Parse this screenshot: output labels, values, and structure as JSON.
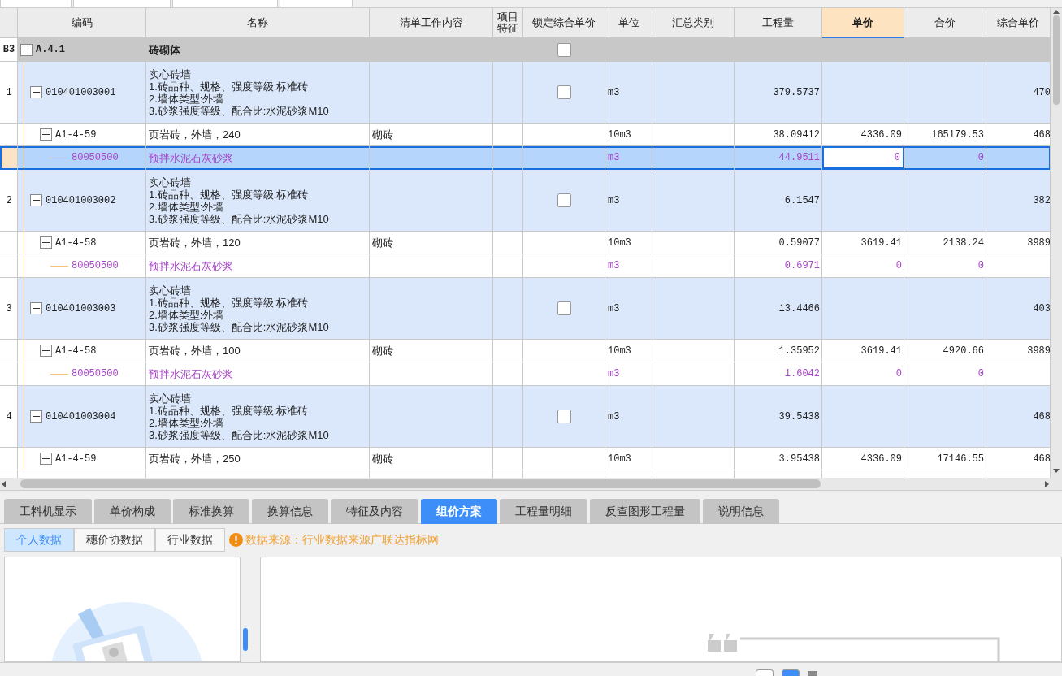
{
  "table": {
    "columns": [
      {
        "selected": false
      },
      {
        "label": "编码",
        "selected": false
      },
      {
        "label": "名称",
        "selected": false
      },
      {
        "label": "清单工作内容",
        "selected": false
      },
      {
        "label": "项目特征",
        "selected": false
      },
      {
        "label": "锁定综合单价",
        "selected": false
      },
      {
        "label": "单位",
        "selected": false
      },
      {
        "label": "汇总类别",
        "selected": false
      },
      {
        "label": "工程量",
        "selected": false
      },
      {
        "label": "单价",
        "selected": true
      },
      {
        "label": "合价",
        "selected": false
      },
      {
        "label": "综合单价",
        "selected": false
      }
    ],
    "rows": [
      {
        "kind": "group",
        "row_no": "B3",
        "code": "A.4.1",
        "name_lines": [
          "砖砌体"
        ],
        "expanded": true,
        "locked": false,
        "selected": false,
        "children": [
          {
            "kind": "item",
            "row_no": "1",
            "code": "010401003001",
            "name_lines": [
              "实心砖墙",
              "1.砖品种、规格、强度等级:标准砖",
              "2.墙体类型:外墙",
              "3.砂浆强度等级、配合比:水泥砂浆M10"
            ],
            "unit": "m3",
            "quantity": "379.5737",
            "composite": "470",
            "expanded": true,
            "locked": false,
            "selected": false,
            "children": [
              {
                "kind": "sub",
                "code": "A1-4-59",
                "name_lines": [
                  "页岩砖，外墙，240"
                ],
                "work": "砌砖",
                "unit": "10m3",
                "quantity": "38.09412",
                "price": "4336.09",
                "total": "165179.53",
                "composite": "468",
                "expanded": true,
                "selected": false,
                "children": [
                  {
                    "kind": "material",
                    "code": "80050500",
                    "name_lines": [
                      "预拌水泥石灰砂浆"
                    ],
                    "unit": "m3",
                    "quantity": "44.9511",
                    "price": "0",
                    "total": "0",
                    "selected": true
                  }
                ]
              }
            ]
          },
          {
            "kind": "item",
            "row_no": "2",
            "code": "010401003002",
            "name_lines": [
              "实心砖墙",
              "1.砖品种、规格、强度等级:标准砖",
              "2.墙体类型:外墙",
              "3.砂浆强度等级、配合比:水泥砂浆M10"
            ],
            "unit": "m3",
            "quantity": "6.1547",
            "composite": "382",
            "expanded": true,
            "locked": false,
            "selected": false,
            "children": [
              {
                "kind": "sub",
                "code": "A1-4-58",
                "name_lines": [
                  "页岩砖，外墙，120"
                ],
                "work": "砌砖",
                "unit": "10m3",
                "quantity": "0.59077",
                "price": "3619.41",
                "total": "2138.24",
                "composite": "3989",
                "expanded": true,
                "selected": false,
                "children": [
                  {
                    "kind": "material",
                    "code": "80050500",
                    "name_lines": [
                      "预拌水泥石灰砂浆"
                    ],
                    "unit": "m3",
                    "quantity": "0.6971",
                    "price": "0",
                    "total": "0",
                    "selected": false
                  }
                ]
              }
            ]
          },
          {
            "kind": "item",
            "row_no": "3",
            "code": "010401003003",
            "name_lines": [
              "实心砖墙",
              "1.砖品种、规格、强度等级:标准砖",
              "2.墙体类型:外墙",
              "3.砂浆强度等级、配合比:水泥砂浆M10"
            ],
            "unit": "m3",
            "quantity": "13.4466",
            "composite": "403",
            "expanded": true,
            "locked": false,
            "selected": false,
            "children": [
              {
                "kind": "sub",
                "code": "A1-4-58",
                "name_lines": [
                  "页岩砖，外墙，100"
                ],
                "work": "砌砖",
                "unit": "10m3",
                "quantity": "1.35952",
                "price": "3619.41",
                "total": "4920.66",
                "composite": "3989",
                "expanded": true,
                "selected": false,
                "children": [
                  {
                    "kind": "material",
                    "code": "80050500",
                    "name_lines": [
                      "预拌水泥石灰砂浆"
                    ],
                    "unit": "m3",
                    "quantity": "1.6042",
                    "price": "0",
                    "total": "0",
                    "selected": false
                  }
                ]
              }
            ]
          },
          {
            "kind": "item",
            "row_no": "4",
            "code": "010401003004",
            "name_lines": [
              "实心砖墙",
              "1.砖品种、规格、强度等级:标准砖",
              "2.墙体类型:外墙",
              "3.砂浆强度等级、配合比:水泥砂浆M10"
            ],
            "unit": "m3",
            "quantity": "39.5438",
            "composite": "468",
            "expanded": true,
            "locked": false,
            "selected": false,
            "children": [
              {
                "kind": "sub",
                "code": "A1-4-59",
                "name_lines": [
                  "页岩砖，外墙，250"
                ],
                "work": "砌砖",
                "unit": "10m3",
                "quantity": "3.95438",
                "price": "4336.09",
                "total": "17146.55",
                "composite": "468",
                "expanded": true,
                "selected": false
              }
            ]
          }
        ]
      }
    ]
  },
  "detail_tabs": [
    {
      "label": "工料机显示",
      "selected": false
    },
    {
      "label": "单价构成",
      "selected": false
    },
    {
      "label": "标准换算",
      "selected": false
    },
    {
      "label": "换算信息",
      "selected": false
    },
    {
      "label": "特征及内容",
      "selected": false
    },
    {
      "label": "组价方案",
      "selected": true
    },
    {
      "label": "工程量明细",
      "selected": false
    },
    {
      "label": "反查图形工程量",
      "selected": false
    },
    {
      "label": "说明信息",
      "selected": false
    }
  ],
  "data_tabs": [
    {
      "label": "个人数据",
      "selected": true
    },
    {
      "label": "穗价协数据",
      "selected": false
    },
    {
      "label": "行业数据",
      "selected": false
    }
  ],
  "notice": "数据来源：行业数据来源广联达指标网"
}
